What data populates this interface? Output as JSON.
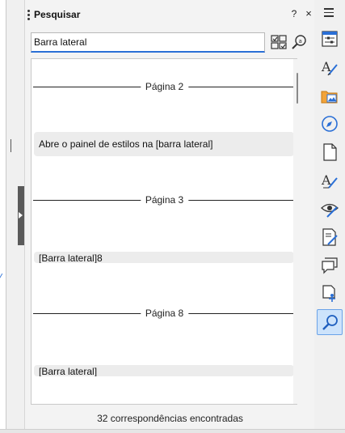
{
  "deck": {
    "title": "Pesquisar",
    "help": "?",
    "close": "×"
  },
  "search": {
    "value": "Barra lateral"
  },
  "results": {
    "groups": [
      {
        "page": "Página 2",
        "hit": "Abre o painel de estilos na [barra lateral]"
      },
      {
        "page": "Página 3",
        "hit": "[Barra lateral]8"
      },
      {
        "page": "Página 8",
        "hit": "[Barra lateral]"
      }
    ]
  },
  "status": "32 correspondências encontradas",
  "tabs": [
    "properties-icon",
    "styles-icon",
    "gallery-icon",
    "navigator-icon",
    "page-icon",
    "style-inspector-icon",
    "manage-changes-icon",
    "design-icon",
    "comments-icon",
    "accessibility-check-icon",
    "find-icon"
  ],
  "colors": {
    "accent": "#2a6fd6",
    "active_tab": "#cde3fb"
  }
}
